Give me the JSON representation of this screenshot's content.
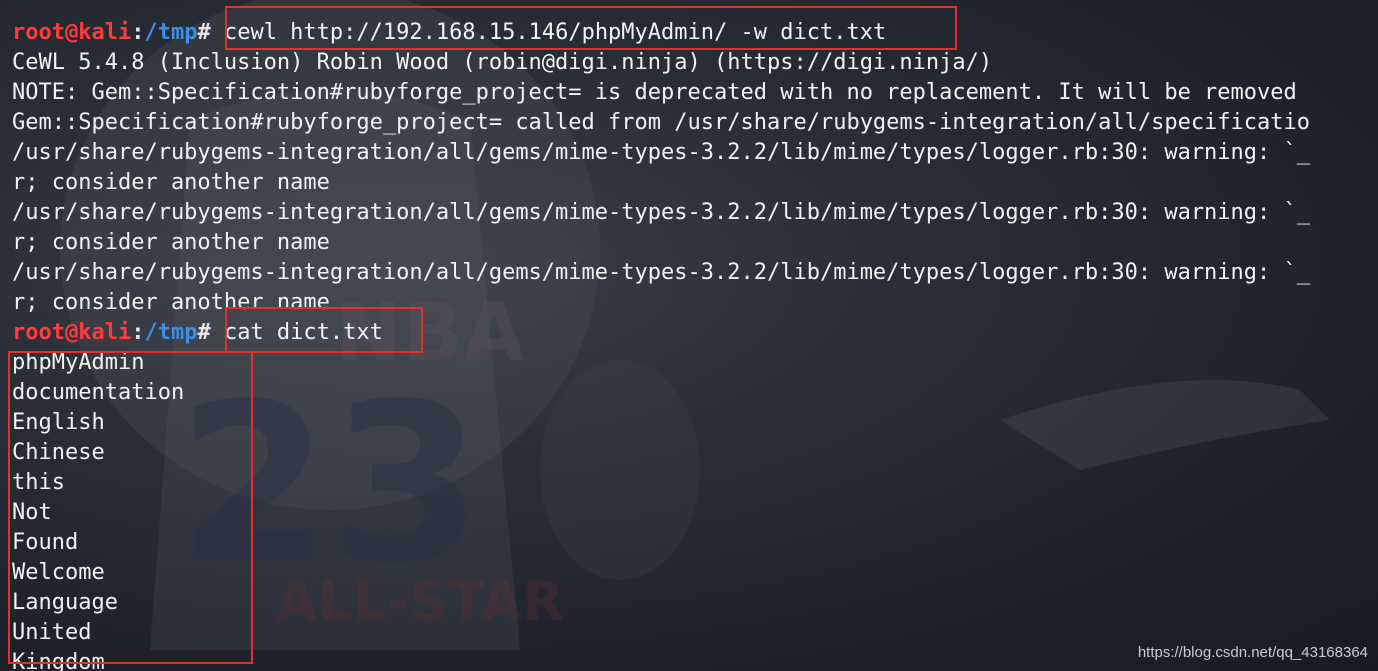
{
  "prompt": {
    "user": "root",
    "at": "@",
    "host": "kali",
    "colon": ":",
    "path": "/tmp",
    "hash": "#"
  },
  "commands": {
    "first": "cewl http://192.168.15.146/phpMyAdmin/ -w dict.txt",
    "second": "cat dict.txt"
  },
  "output_lines": [
    "CeWL 5.4.8 (Inclusion) Robin Wood (robin@digi.ninja) (https://digi.ninja/)",
    "NOTE: Gem::Specification#rubyforge_project= is deprecated with no replacement. It will be removed",
    "Gem::Specification#rubyforge_project= called from /usr/share/rubygems-integration/all/specificatio",
    "/usr/share/rubygems-integration/all/gems/mime-types-3.2.2/lib/mime/types/logger.rb:30: warning: `_",
    "r; consider another name",
    "/usr/share/rubygems-integration/all/gems/mime-types-3.2.2/lib/mime/types/logger.rb:30: warning: `_",
    "r; consider another name",
    "/usr/share/rubygems-integration/all/gems/mime-types-3.2.2/lib/mime/types/logger.rb:30: warning: `_",
    "r; consider another name"
  ],
  "dict_words": [
    "phpMyAdmin",
    "documentation",
    "English",
    "Chinese",
    "this",
    "Not",
    "Found",
    "Welcome",
    "Language",
    "United",
    "Kingdom"
  ],
  "watermark": "https://blog.csdn.net/qq_43168364",
  "colors": {
    "prompt_user": "#ff3b3b",
    "prompt_path": "#3b8eea",
    "highlight_box": "#e03030",
    "text": "#f2f2f2"
  }
}
